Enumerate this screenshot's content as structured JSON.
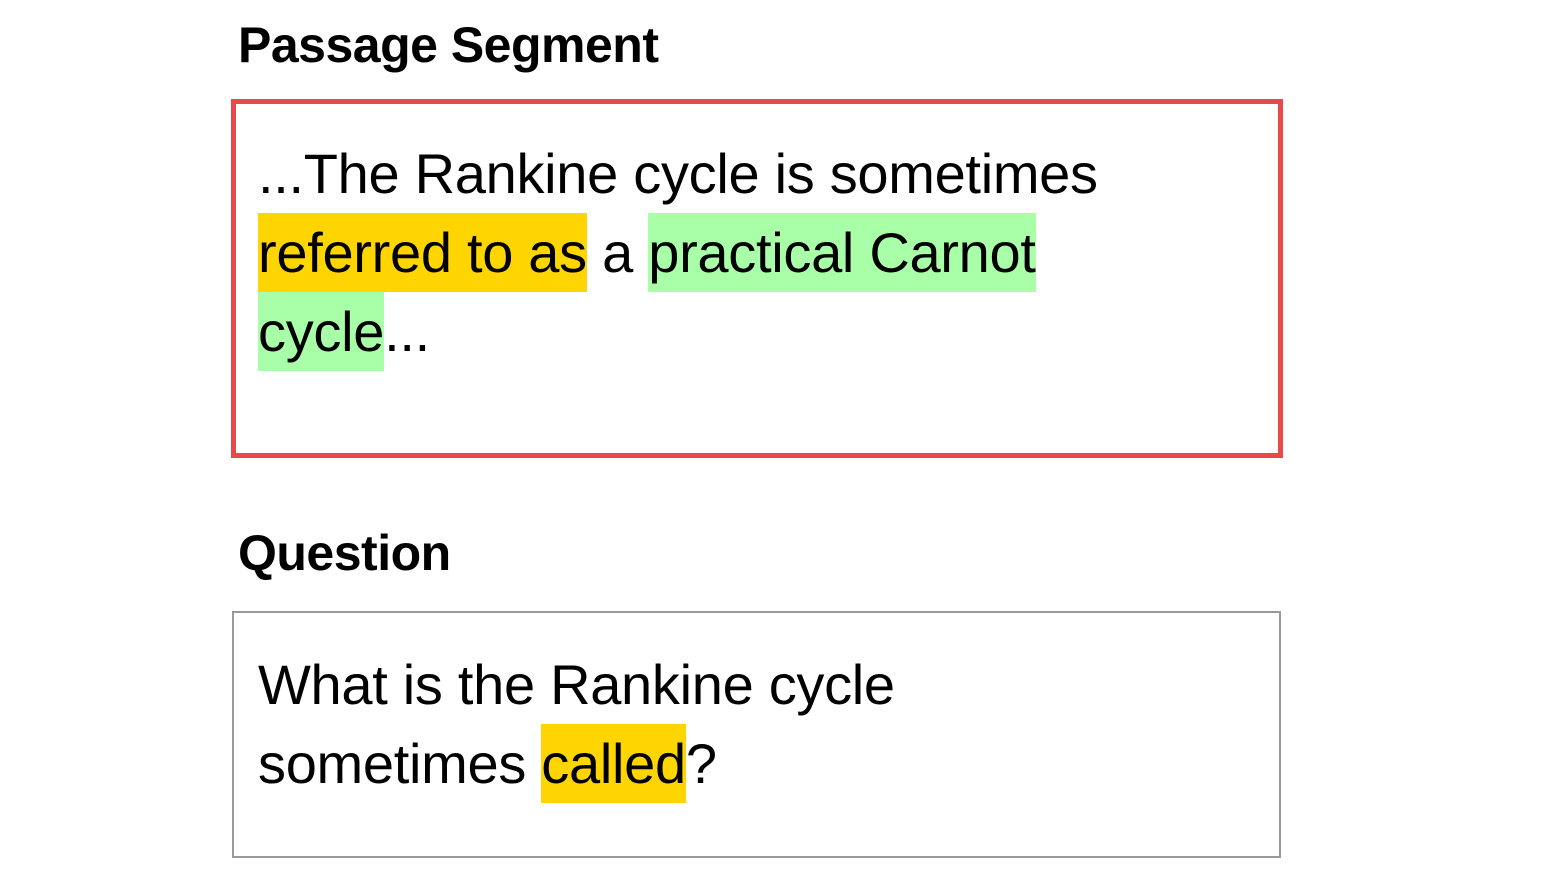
{
  "passage": {
    "title": "Passage Segment",
    "lines": [
      [
        {
          "text": "...The Rankine cycle is sometimes",
          "highlight": null
        }
      ],
      [
        {
          "text": "referred to as",
          "highlight": "yellow"
        },
        {
          "text": " a ",
          "highlight": null
        },
        {
          "text": "practical Carnot",
          "highlight": "green"
        }
      ],
      [
        {
          "text": "cycle",
          "highlight": "green"
        },
        {
          "text": "...",
          "highlight": null
        }
      ]
    ],
    "border_color": "#e84a4a"
  },
  "question": {
    "title": "Question",
    "lines": [
      [
        {
          "text": "What is the Rankine cycle",
          "highlight": null
        }
      ],
      [
        {
          "text": "sometimes ",
          "highlight": null
        },
        {
          "text": "called",
          "highlight": "yellow"
        },
        {
          "text": "?",
          "highlight": null
        }
      ]
    ],
    "border_color": "#999999"
  },
  "colors": {
    "highlight_yellow": "#ffd500",
    "highlight_green": "#a8ffa8"
  }
}
